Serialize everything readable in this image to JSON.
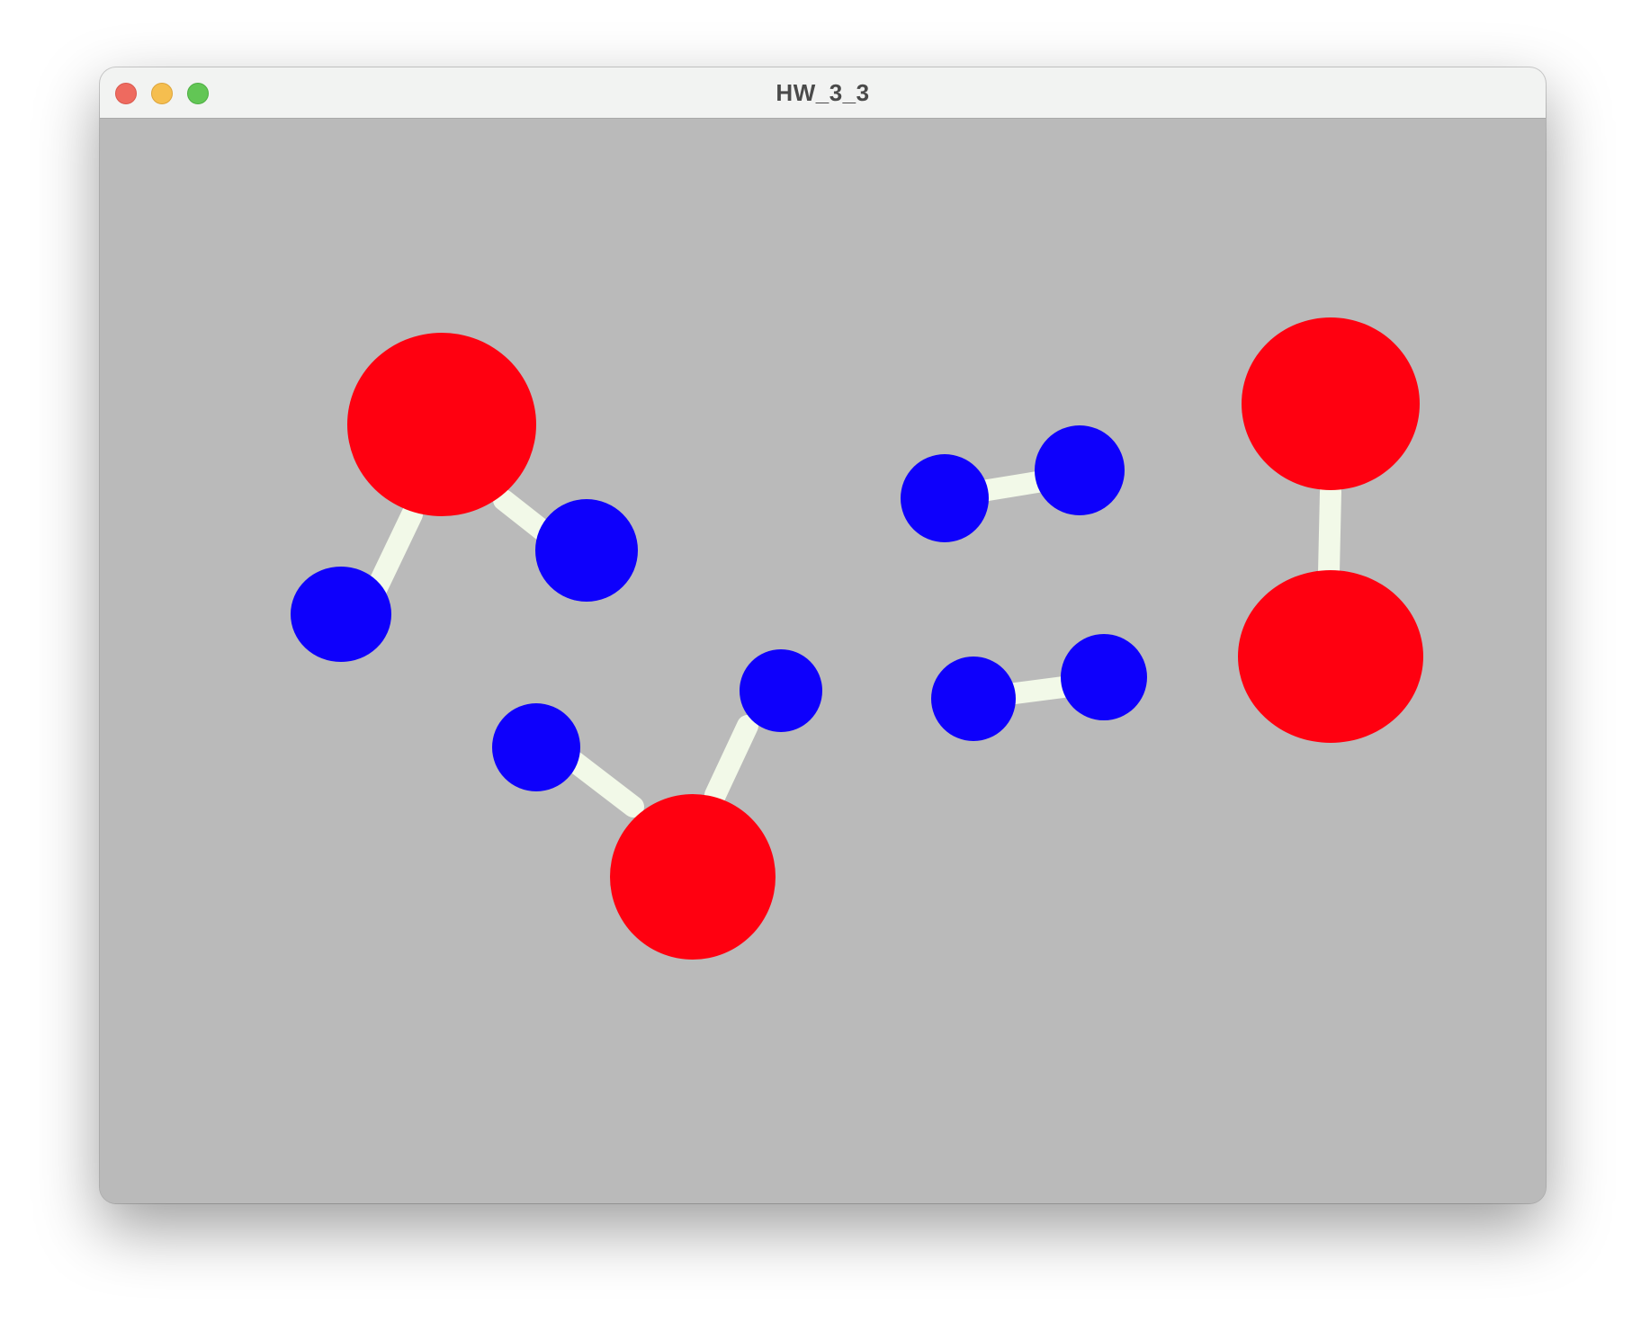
{
  "window": {
    "title": "HW_3_3",
    "buttons": {
      "close": "close",
      "minimize": "minimize",
      "zoom": "zoom"
    }
  },
  "scene": {
    "background_color": "#bababa",
    "atom_colors": {
      "oxygen": "#ff0010",
      "hydrogen": "#0e00fc"
    },
    "bond_color": "#f2f9e8",
    "molecules": [
      {
        "name": "water-molecule-1",
        "atoms": [
          "oxygen",
          "hydrogen",
          "hydrogen"
        ]
      },
      {
        "name": "water-molecule-2",
        "atoms": [
          "oxygen",
          "hydrogen",
          "hydrogen"
        ]
      },
      {
        "name": "hydrogen-molecule-1",
        "atoms": [
          "hydrogen",
          "hydrogen"
        ]
      },
      {
        "name": "hydrogen-molecule-2",
        "atoms": [
          "hydrogen",
          "hydrogen"
        ]
      },
      {
        "name": "oxygen-molecule",
        "atoms": [
          "oxygen",
          "oxygen"
        ]
      }
    ]
  }
}
